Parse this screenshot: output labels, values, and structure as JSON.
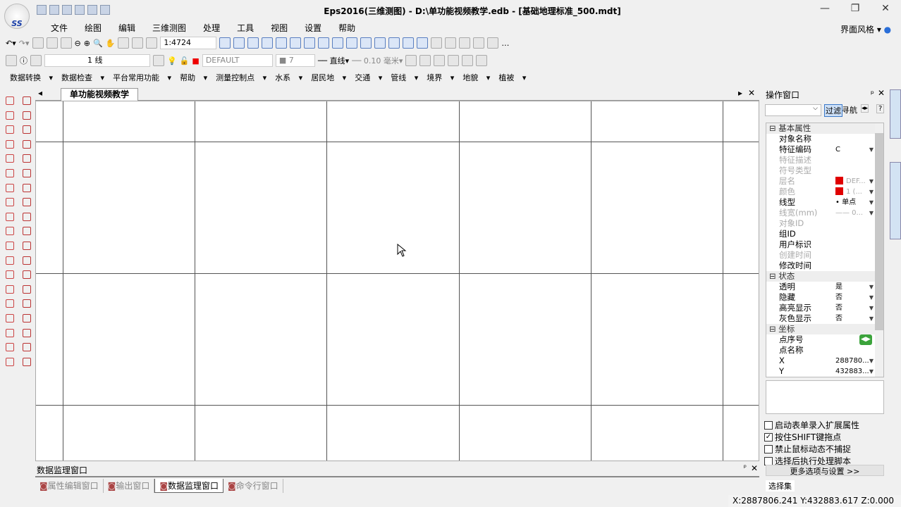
{
  "app": {
    "title": "Eps2016(三维测图) -  D:\\单功能视频教学.edb - [基础地理标准_500.mdt]",
    "logo": "SS",
    "ui_style": "界面风格"
  },
  "menu": [
    "文件",
    "绘图",
    "编辑",
    "三维测图",
    "处理",
    "工具",
    "视图",
    "设置",
    "帮助"
  ],
  "toolbar": {
    "scale": "1:4724",
    "layer_line": "1 线",
    "layer": "DEFAULT",
    "color_index": "7",
    "line_type": "直线",
    "line_width": "0.10 毫米"
  },
  "toolbar3": [
    "数据转换",
    "数据检查",
    "平台常用功能",
    "帮助",
    "测量控制点",
    "水系",
    "居民地",
    "交通",
    "管线",
    "境界",
    "地貌",
    "植被"
  ],
  "doc_tab": "单功能视频教学",
  "panel": {
    "title": "操作窗口",
    "filter": "过滤",
    "nav": "寻航",
    "rows": [
      {
        "k": "基本属性",
        "grp": true
      },
      {
        "k": "对象名称"
      },
      {
        "k": "特征编码",
        "v": "C"
      },
      {
        "k": "特征描述",
        "dim": true
      },
      {
        "k": "符号类型",
        "dim": true
      },
      {
        "k": "层名",
        "v": "DEF...",
        "dim": true,
        "swatch": "#e00000"
      },
      {
        "k": "颜色",
        "v": "1 (...",
        "dim": true,
        "swatch": "#e00000"
      },
      {
        "k": "线型",
        "v": "• 单点"
      },
      {
        "k": "线宽(mm)",
        "v": "—— 0...",
        "dim": true
      },
      {
        "k": "对象ID",
        "dim": true
      },
      {
        "k": "组ID"
      },
      {
        "k": "用户标识"
      },
      {
        "k": "创建时间",
        "dim": true
      },
      {
        "k": "修改时间"
      },
      {
        "k": "状态",
        "grp": true
      },
      {
        "k": "透明",
        "v": "是"
      },
      {
        "k": "隐藏",
        "v": "否"
      },
      {
        "k": "高亮显示",
        "v": "否"
      },
      {
        "k": "灰色显示",
        "v": "否"
      },
      {
        "k": "坐标",
        "grp": true
      },
      {
        "k": "点序号"
      },
      {
        "k": "点名称"
      },
      {
        "k": "X",
        "v": "288780..."
      },
      {
        "k": "Y",
        "v": "432883..."
      }
    ],
    "checks": [
      {
        "label": "启动表单录入扩展属性",
        "checked": false
      },
      {
        "label": "按住SHIFT键拖点",
        "checked": true
      },
      {
        "label": "禁止鼠标动态不捕捉",
        "checked": false
      },
      {
        "label": "选择后执行处理脚本",
        "checked": false
      }
    ],
    "more": "更多选项与设置 >>",
    "selection_tab": "选择集"
  },
  "bottom": {
    "title": "数据监理窗口",
    "tabs": [
      "属性编辑窗口",
      "输出窗口",
      "数据监理窗口",
      "命令行窗口"
    ],
    "active": 2
  },
  "status": "X:2887806.241 Y:432883.617 Z:0.000"
}
